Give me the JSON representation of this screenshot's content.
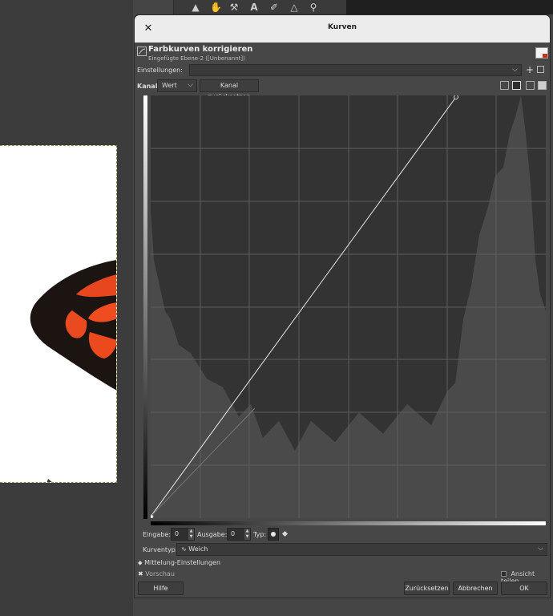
{
  "dialog": {
    "window_title": "Kurven",
    "heading": "Farbkurven korrigieren",
    "subheading": "Eingefügte Ebene-2 ([Unbenannt])",
    "presets_label": "Einstellungen:",
    "presets_value": "",
    "channel_label": "Kanal:",
    "channel_value": "Wert",
    "reset_channel_label": "Kanal zurücksetzen",
    "input_label": "Eingabe:",
    "input_value": "0",
    "output_label": "Ausgabe:",
    "output_value": "0",
    "type_label": "Typ:",
    "curve_type_label": "Kurventyp:",
    "curve_type_value": "Weich",
    "blend_options_label": "Mittelung-Einstellungen",
    "preview_label": "Vorschau",
    "split_view_label": "Ansicht teilen",
    "help_label": "Hilfe",
    "reset_label": "Zurücksetzen",
    "cancel_label": "Abbrechen",
    "ok_label": "OK"
  },
  "icons": {
    "close": "close-icon",
    "add_preset": "plus-icon",
    "preset_menu": "menu-icon",
    "chevron": "chevron-down-icon",
    "curve_type": "curve-smooth-icon",
    "tools": [
      "ink-tool-icon",
      "smudge-tool-icon",
      "path-tool-icon",
      "text-tool-icon",
      "color-picker-icon",
      "measure-tool-icon",
      "zoom-icon"
    ]
  },
  "colors": {
    "dialog_bg": "#474747",
    "curve_bg": "#333333",
    "histogram": "#4a4a4a",
    "curve_line": "#e8e8e8",
    "titlebar": "#ececec"
  },
  "curve": {
    "points": [
      [
        0,
        0
      ],
      [
        255,
        255
      ]
    ],
    "note_range": [
      0,
      255
    ]
  }
}
